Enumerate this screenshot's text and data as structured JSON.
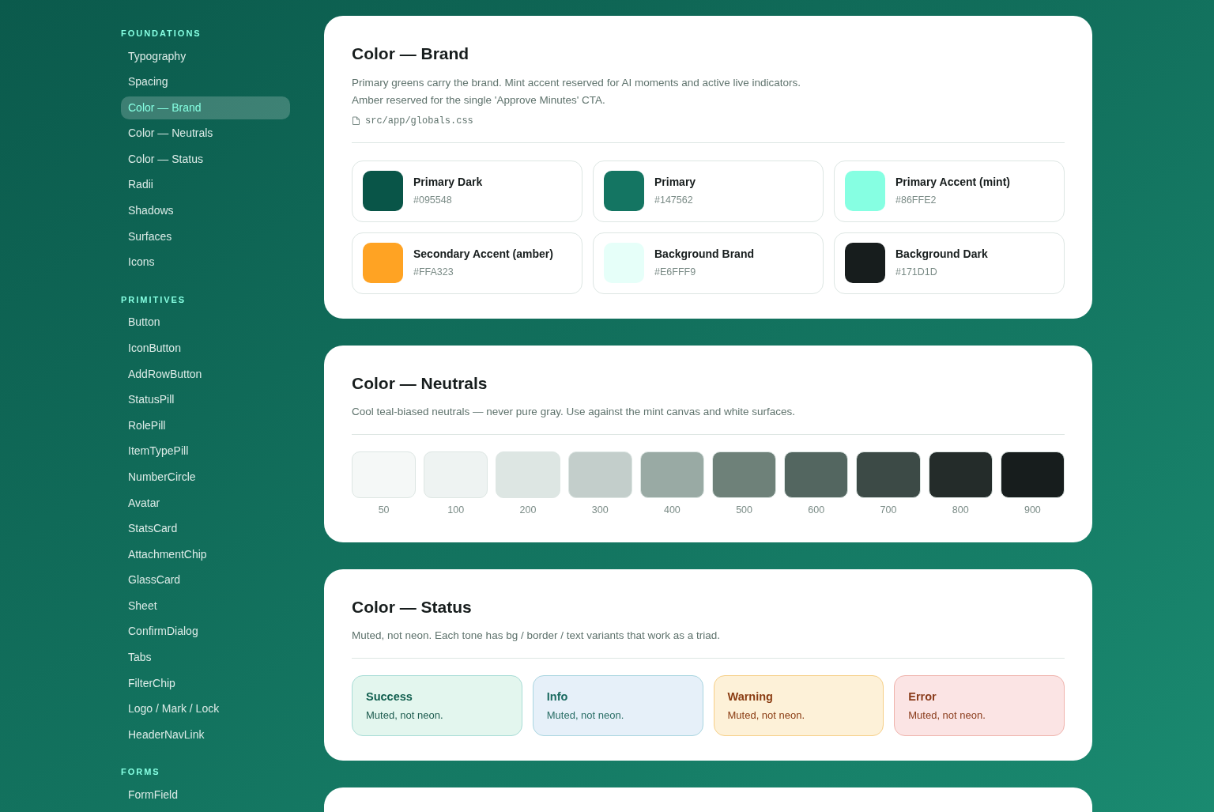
{
  "sidebar": {
    "sections": [
      {
        "title": "FOUNDATIONS",
        "items": [
          {
            "label": "Typography",
            "selected": false
          },
          {
            "label": "Spacing",
            "selected": false
          },
          {
            "label": "Color — Brand",
            "selected": true
          },
          {
            "label": "Color — Neutrals",
            "selected": false
          },
          {
            "label": "Color — Status",
            "selected": false
          },
          {
            "label": "Radii",
            "selected": false
          },
          {
            "label": "Shadows",
            "selected": false
          },
          {
            "label": "Surfaces",
            "selected": false
          },
          {
            "label": "Icons",
            "selected": false
          }
        ]
      },
      {
        "title": "PRIMITIVES",
        "items": [
          {
            "label": "Button",
            "selected": false
          },
          {
            "label": "IconButton",
            "selected": false
          },
          {
            "label": "AddRowButton",
            "selected": false
          },
          {
            "label": "StatusPill",
            "selected": false
          },
          {
            "label": "RolePill",
            "selected": false
          },
          {
            "label": "ItemTypePill",
            "selected": false
          },
          {
            "label": "NumberCircle",
            "selected": false
          },
          {
            "label": "Avatar",
            "selected": false
          },
          {
            "label": "StatsCard",
            "selected": false
          },
          {
            "label": "AttachmentChip",
            "selected": false
          },
          {
            "label": "GlassCard",
            "selected": false
          },
          {
            "label": "Sheet",
            "selected": false
          },
          {
            "label": "ConfirmDialog",
            "selected": false
          },
          {
            "label": "Tabs",
            "selected": false
          },
          {
            "label": "FilterChip",
            "selected": false
          },
          {
            "label": "Logo / Mark / Lock",
            "selected": false
          },
          {
            "label": "HeaderNavLink",
            "selected": false
          }
        ]
      },
      {
        "title": "FORMS",
        "items": [
          {
            "label": "FormField",
            "selected": false
          }
        ]
      }
    ]
  },
  "brand": {
    "title": "Color — Brand",
    "description": [
      "Primary greens carry the brand. Mint accent reserved for AI moments and active live indicators.",
      "Amber reserved for the single 'Approve Minutes' CTA."
    ],
    "file": "src/app/globals.css",
    "swatches": [
      {
        "name": "Primary Dark",
        "hex": "#095548",
        "color": "#095548"
      },
      {
        "name": "Primary",
        "hex": "#147562",
        "color": "#147562"
      },
      {
        "name": "Primary Accent (mint)",
        "hex": "#86FFE2",
        "color": "#86ffe2"
      },
      {
        "name": "Secondary Accent (amber)",
        "hex": "#FFA323",
        "color": "#ffa323"
      },
      {
        "name": "Background Brand",
        "hex": "#E6FFF9",
        "color": "#e6fff9"
      },
      {
        "name": "Background Dark",
        "hex": "#171D1D",
        "color": "#171d1d"
      }
    ]
  },
  "neutrals": {
    "title": "Color — Neutrals",
    "description": "Cool teal-biased neutrals — never pure gray. Use against the mint canvas and white surfaces.",
    "swatches": [
      {
        "label": "50",
        "color": "#f5f8f7"
      },
      {
        "label": "100",
        "color": "#eef3f2"
      },
      {
        "label": "200",
        "color": "#dde6e3"
      },
      {
        "label": "300",
        "color": "#c3cecb"
      },
      {
        "label": "400",
        "color": "#99aaa4"
      },
      {
        "label": "500",
        "color": "#6e8179"
      },
      {
        "label": "600",
        "color": "#536660"
      },
      {
        "label": "700",
        "color": "#3c4a46"
      },
      {
        "label": "800",
        "color": "#242c2a"
      },
      {
        "label": "900",
        "color": "#171d1d"
      }
    ]
  },
  "status": {
    "title": "Color — Status",
    "description": "Muted, not neon. Each tone has bg / border / text variants that work as a triad.",
    "tones": [
      {
        "kind": "success",
        "title": "Success",
        "text": "Muted, not neon."
      },
      {
        "kind": "info",
        "title": "Info",
        "text": "Muted, not neon."
      },
      {
        "kind": "warning",
        "title": "Warning",
        "text": "Muted, not neon."
      },
      {
        "kind": "error",
        "title": "Error",
        "text": "Muted, not neon."
      }
    ]
  }
}
